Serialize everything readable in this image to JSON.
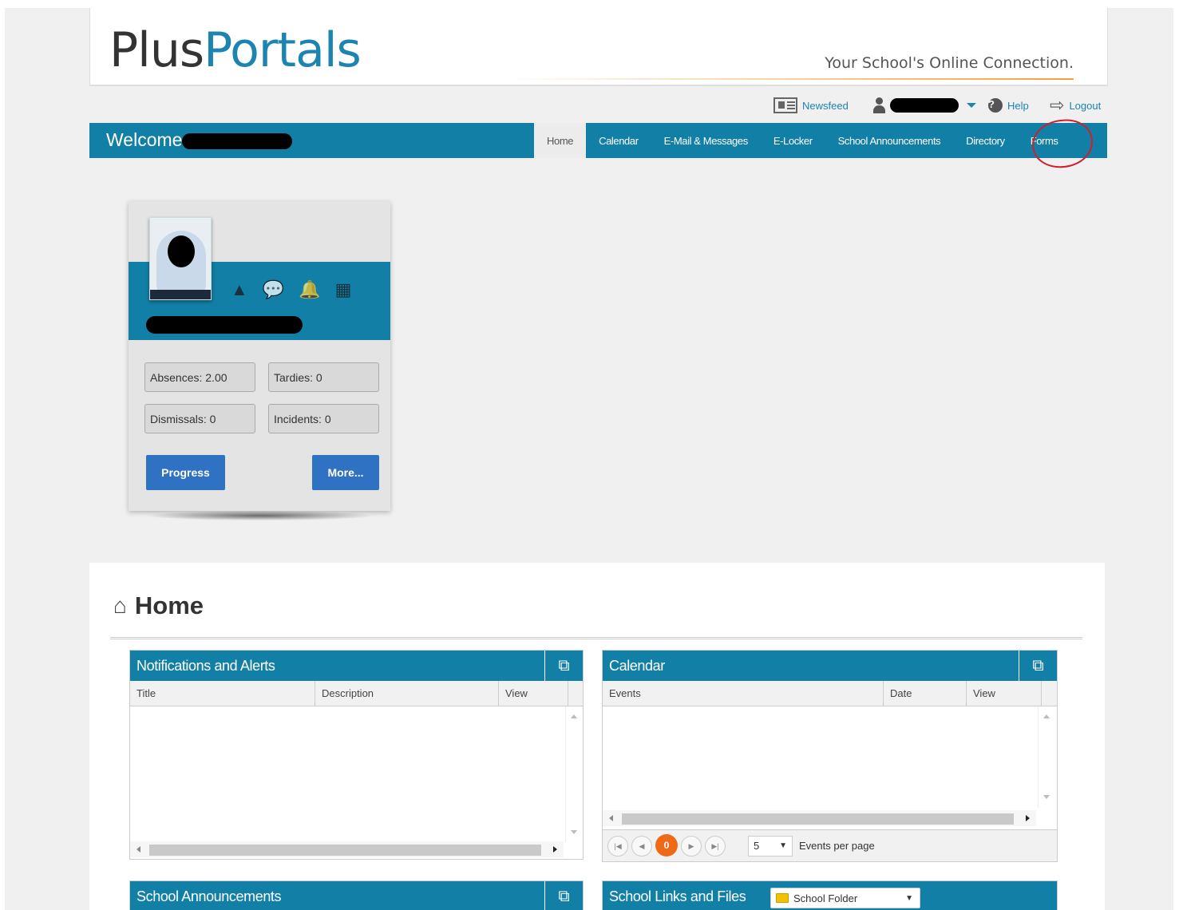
{
  "brand": {
    "logo_plus": "Plus",
    "logo_portals": "Portals",
    "tagline": "Your School's Online Connection."
  },
  "util": {
    "newsfeed": "Newsfeed",
    "help": "Help",
    "logout": "Logout"
  },
  "nav": {
    "welcome": "Welcome",
    "tabs": [
      "Home",
      "Calendar",
      "E-Mail & Messages",
      "E-Locker",
      "School Announcements",
      "Directory",
      "Forms"
    ],
    "active_tab": "Home"
  },
  "student_card": {
    "absences": "Absences: 2.00",
    "tardies": "Tardies: 0",
    "dismissals": "Dismissals: 0",
    "incidents": "Incidents: 0",
    "progress_btn": "Progress",
    "more_btn": "More..."
  },
  "home": {
    "title": "Home",
    "notifications": {
      "title": "Notifications and Alerts",
      "columns": [
        "Title",
        "Description",
        "View"
      ]
    },
    "calendar": {
      "title": "Calendar",
      "columns": [
        "Events",
        "Date",
        "View"
      ],
      "current_page": "0",
      "page_size": "5",
      "per_page_label": "Events per page"
    },
    "announcements": {
      "title": "School Announcements"
    },
    "links": {
      "title": "School Links and Files",
      "folder": "School Folder"
    }
  },
  "colors": {
    "nav_blue": "#127fa6",
    "button_blue": "#2f71c2",
    "pager_orange": "#ef6a16",
    "annotation_red": "#d01f2b"
  }
}
